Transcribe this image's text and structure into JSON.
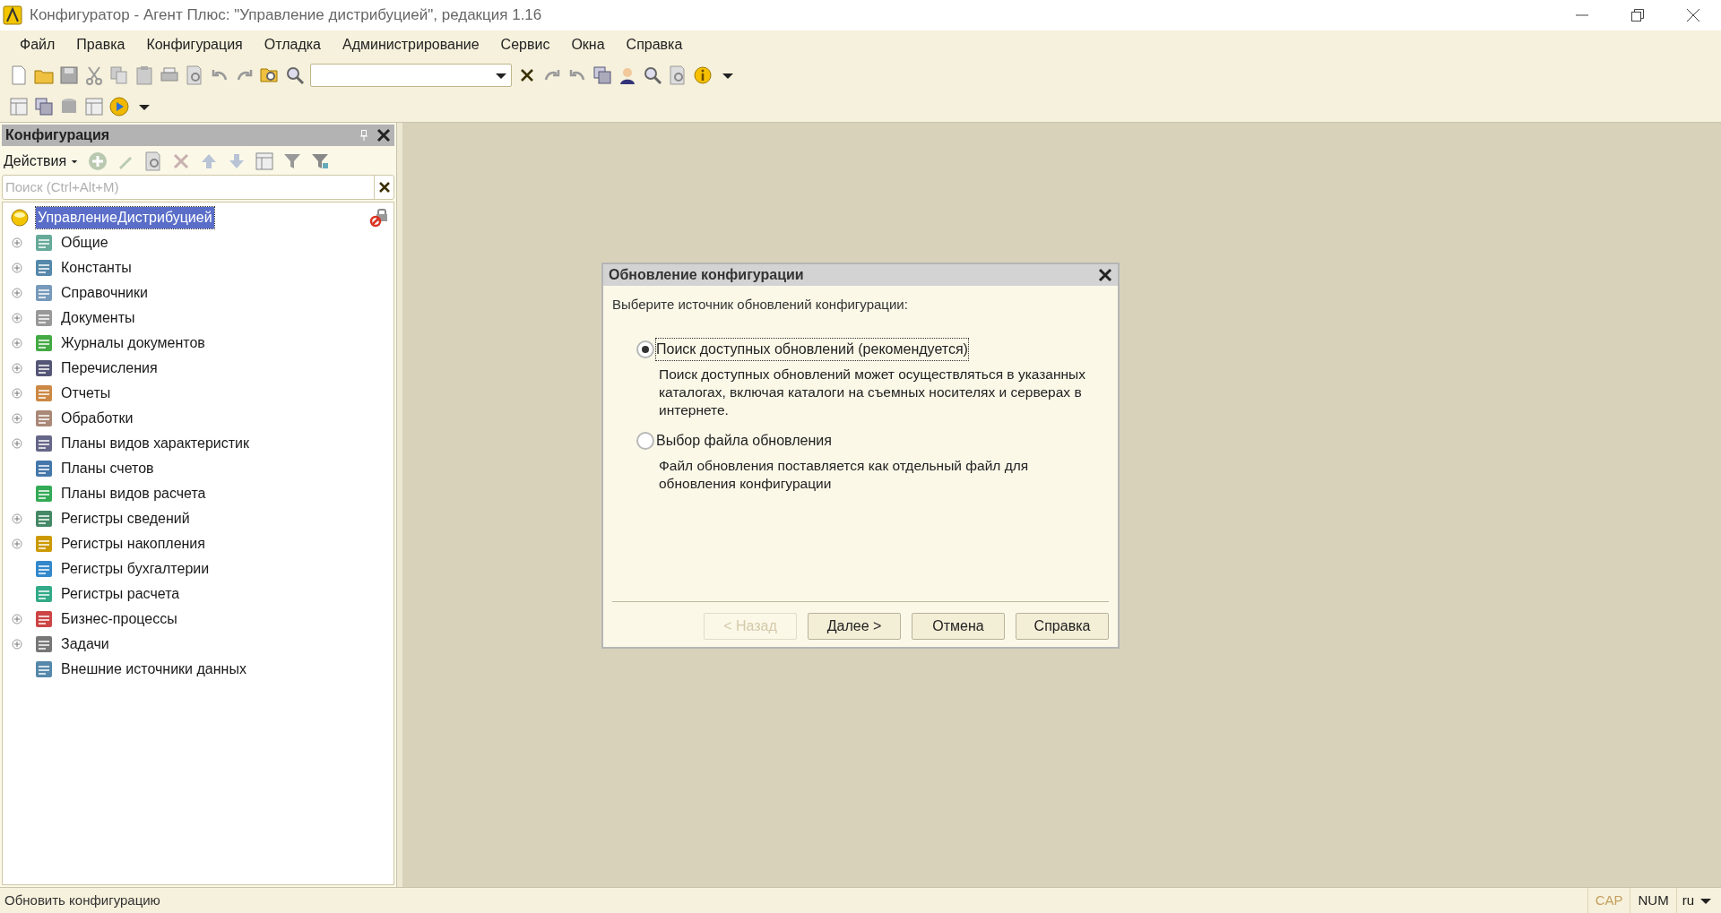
{
  "window": {
    "title": "Конфигуратор - Агент Плюс: \"Управление дистрибуцией\", редакция 1.16"
  },
  "menu": [
    "Файл",
    "Правка",
    "Конфигурация",
    "Отладка",
    "Администрирование",
    "Сервис",
    "Окна",
    "Справка"
  ],
  "panel": {
    "title": "Конфигурация",
    "actions_label": "Действия",
    "search": {
      "placeholder": "Поиск (Ctrl+Alt+M)"
    },
    "root": {
      "label": "УправлениеДистрибуцией",
      "selected": true
    },
    "items": [
      {
        "label": "Общие",
        "expandable": true
      },
      {
        "label": "Константы",
        "expandable": true
      },
      {
        "label": "Справочники",
        "expandable": true
      },
      {
        "label": "Документы",
        "expandable": true
      },
      {
        "label": "Журналы документов",
        "expandable": true
      },
      {
        "label": "Перечисления",
        "expandable": true
      },
      {
        "label": "Отчеты",
        "expandable": true
      },
      {
        "label": "Обработки",
        "expandable": true
      },
      {
        "label": "Планы видов характеристик",
        "expandable": true
      },
      {
        "label": "Планы счетов",
        "expandable": false
      },
      {
        "label": "Планы видов расчета",
        "expandable": false
      },
      {
        "label": "Регистры сведений",
        "expandable": true
      },
      {
        "label": "Регистры накопления",
        "expandable": true
      },
      {
        "label": "Регистры бухгалтерии",
        "expandable": false
      },
      {
        "label": "Регистры расчета",
        "expandable": false
      },
      {
        "label": "Бизнес-процессы",
        "expandable": true
      },
      {
        "label": "Задачи",
        "expandable": true
      },
      {
        "label": "Внешние источники данных",
        "expandable": false
      }
    ]
  },
  "dialog": {
    "title": "Обновление конфигурации",
    "prompt": "Выберите источник обновлений конфигурации:",
    "options": [
      {
        "label": "Поиск доступных обновлений (рекомендуется)",
        "description": "Поиск доступных обновлений может осуществляться в указанных каталогах, включая каталоги на съемных носителях и серверах в интернете.",
        "selected": true
      },
      {
        "label": "Выбор файла обновления",
        "description": "Файл обновления поставляется как отдельный файл для обновления конфигурации",
        "selected": false
      }
    ],
    "buttons": [
      {
        "label": "< Назад",
        "disabled": true
      },
      {
        "label": "Далее >",
        "disabled": false
      },
      {
        "label": "Отмена",
        "disabled": false
      },
      {
        "label": "Справка",
        "disabled": false
      }
    ]
  },
  "status_bar": {
    "text": "Обновить конфигурацию",
    "indicators": [
      {
        "label": "CAP",
        "on": false
      },
      {
        "label": "NUM",
        "on": true
      }
    ],
    "language": "ru"
  }
}
